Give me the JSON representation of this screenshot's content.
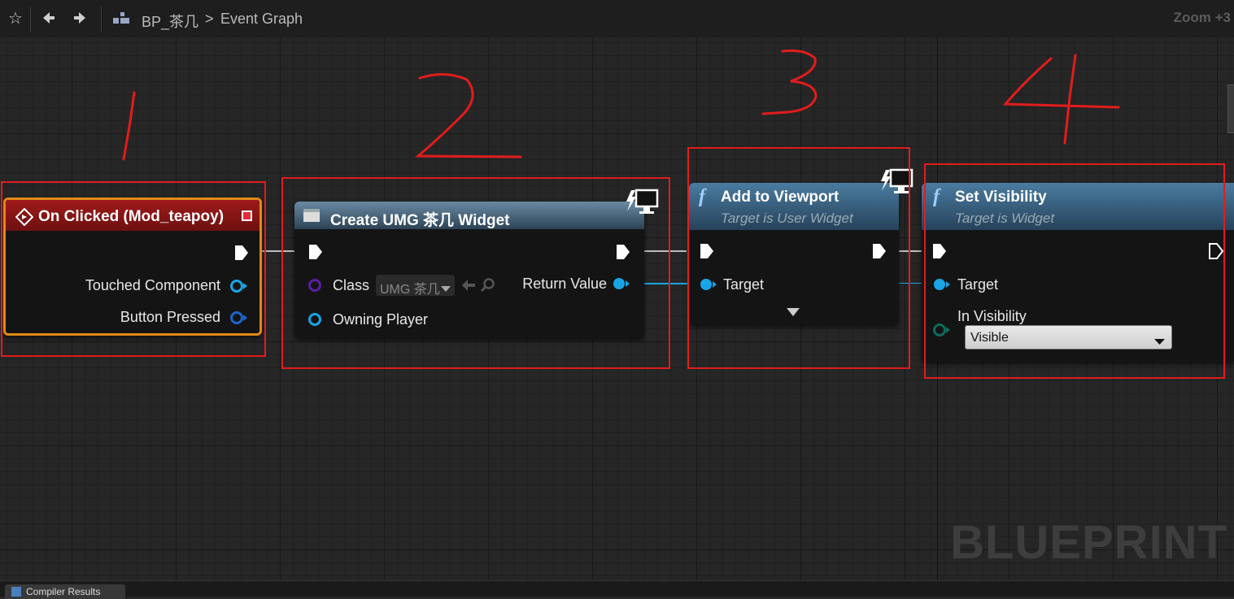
{
  "toolbar": {
    "breadcrumb_blueprint": "BP_茶几",
    "breadcrumb_separator": ">",
    "breadcrumb_graph": "Event Graph",
    "zoom": "Zoom +3"
  },
  "watermark": "BLUEPRINT",
  "annotations": [
    "1",
    "2",
    "3",
    "4"
  ],
  "nodes": {
    "on_clicked": {
      "title": "On Clicked (Mod_teapoy)",
      "pins": {
        "touched_component": "Touched Component",
        "button_pressed": "Button Pressed"
      }
    },
    "create_widget": {
      "title": "Create UMG 茶几 Widget",
      "pins": {
        "class": "Class",
        "class_value": "UMG 茶几",
        "owning_player": "Owning Player",
        "return_value": "Return Value"
      }
    },
    "add_to_viewport": {
      "title": "Add to Viewport",
      "subtitle": "Target is User Widget",
      "pins": {
        "target": "Target"
      }
    },
    "set_visibility": {
      "title": "Set Visibility",
      "subtitle": "Target is Widget",
      "pins": {
        "target": "Target",
        "in_visibility": "In Visibility"
      },
      "visibility_value": "Visible"
    }
  },
  "bottom_tab": "Compiler Results",
  "colors": {
    "event_header": "#8c1515",
    "event_border": "#e08a16",
    "function_header": "#3d6584",
    "create_header": "#4a6478",
    "object_pin": "#17a5e6",
    "class_pin": "#5a1fa0",
    "enum_pin": "#0d6b5a",
    "annotation_red": "#e21c1c"
  }
}
